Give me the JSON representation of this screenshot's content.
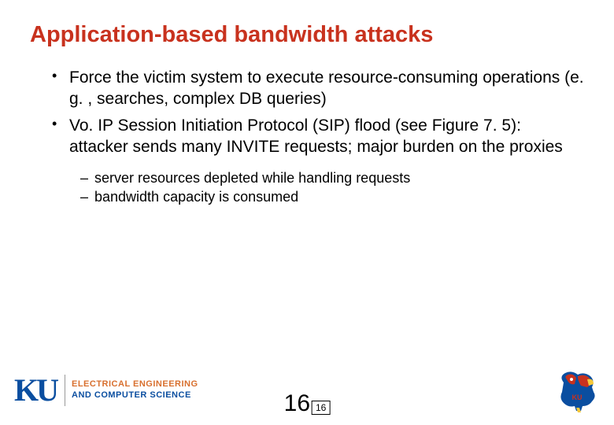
{
  "title": "Application-based bandwidth attacks",
  "bullets": [
    "Force the victim system to execute resource-consuming operations (e. g. , searches, complex DB queries)",
    "Vo. IP Session Initiation Protocol (SIP)  flood (see Figure 7. 5): attacker sends many INVITE requests; major burden on the proxies"
  ],
  "sub_bullets": [
    "server resources depleted while handling requests",
    "bandwidth capacity is consumed"
  ],
  "footer": {
    "ku_mark": "KU",
    "dept_line1": "ELECTRICAL ENGINEERING",
    "dept_line2": "AND COMPUTER SCIENCE",
    "page_big": "16",
    "page_box": "16"
  }
}
